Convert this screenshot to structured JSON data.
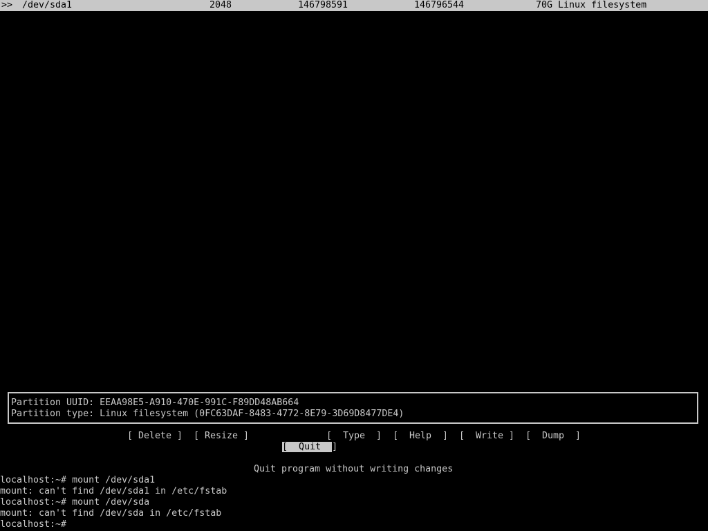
{
  "partition_row": {
    "selector": ">>",
    "device": "/dev/sda1",
    "start": "2048",
    "end": "146798591",
    "sectors": "146796544",
    "size_type": "70G Linux filesystem"
  },
  "info": {
    "uuid_line": "Partition UUID: EEAA98E5-A910-470E-991C-F89DD48AB664",
    "type_line": "Partition type: Linux filesystem (0FC63DAF-8483-4772-8E79-3D69D8477DE4)"
  },
  "menu": {
    "delete": "[ Delete ]",
    "resize": "[ Resize ]",
    "quit_open": "[",
    "quit_label": "  Quit  ",
    "quit_close": "]",
    "type": "[  Type  ]",
    "help": "[  Help  ]",
    "write": "[  Write ]",
    "dump": "[  Dump  ]",
    "description": "Quit program without writing changes"
  },
  "terminal": {
    "line1": "localhost:~# mount /dev/sda1",
    "line2": "mount: can't find /dev/sda1 in /etc/fstab",
    "line3": "localhost:~# mount /dev/sda",
    "line4": "mount: can't find /dev/sda in /etc/fstab",
    "line5": "localhost:~# "
  }
}
